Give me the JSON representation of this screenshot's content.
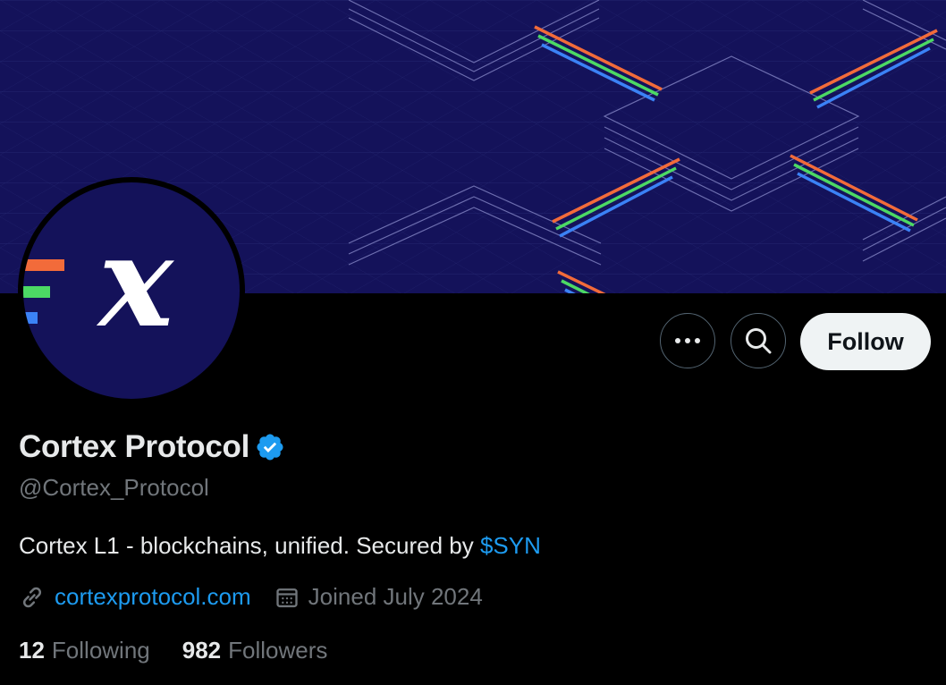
{
  "profile": {
    "name": "Cortex Protocol",
    "handle": "@Cortex_Protocol",
    "bio_text": "Cortex L1 - blockchains, unified. Secured by ",
    "bio_cashtag": "$SYN",
    "website": "cortexprotocol.com",
    "joined": "Joined July 2024",
    "following_count": "12",
    "following_label": "Following",
    "followers_count": "982",
    "followers_label": "Followers",
    "verified": true
  },
  "actions": {
    "follow_label": "Follow",
    "more_icon": "more-icon",
    "search_icon": "search-icon"
  },
  "avatar": {
    "glyph": "x"
  },
  "colors": {
    "banner_bg": "#14125a",
    "accent_blue": "#1d9bf0",
    "stripe_orange": "#f26b3a",
    "stripe_green": "#4cd964",
    "stripe_blue": "#3b82f6"
  }
}
